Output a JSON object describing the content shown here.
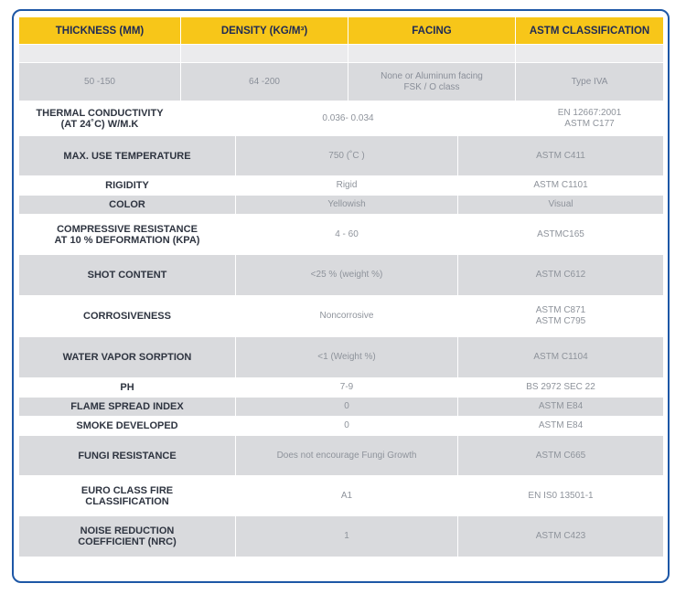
{
  "header": {
    "columns": [
      "THICKNESS (MM)",
      "DENSITY (KG/M³)",
      "FACING",
      "ASTM CLASSIFICATION"
    ]
  },
  "spec_row": {
    "thickness": "50 -150",
    "density": "64 -200",
    "facing_line1": "None or Aluminum facing",
    "facing_line2": "FSK / O class",
    "classification": "Type IVA"
  },
  "properties": [
    {
      "name_line1": "THERMAL CONDUCTIVITY",
      "name_line2": "(AT 24˚C) W/M.K",
      "value": "0.036- 0.034",
      "standard_line1": "EN 12667:2001",
      "standard_line2": "ASTM C177"
    },
    {
      "name_line1": "MAX. USE TEMPERATURE",
      "name_line2": "",
      "value": "750 (˚C )",
      "standard_line1": "ASTM C411",
      "standard_line2": ""
    },
    {
      "name_line1": "RIGIDITY",
      "name_line2": "",
      "value": "Rigid",
      "standard_line1": "ASTM C1101",
      "standard_line2": ""
    },
    {
      "name_line1": "COLOR",
      "name_line2": "",
      "value": "Yellowish",
      "standard_line1": "Visual",
      "standard_line2": ""
    },
    {
      "name_line1": "COMPRESSIVE RESISTANCE",
      "name_line2": "AT 10 % DEFORMATION (KPA)",
      "value": "4 - 60",
      "standard_line1": "ASTMC165",
      "standard_line2": ""
    },
    {
      "name_line1": "SHOT CONTENT",
      "name_line2": "",
      "value": "<25 % (weight %)",
      "standard_line1": "ASTM C612",
      "standard_line2": ""
    },
    {
      "name_line1": "CORROSIVENESS",
      "name_line2": "",
      "value": "Noncorrosive",
      "standard_line1": "ASTM C871",
      "standard_line2": "ASTM C795"
    },
    {
      "name_line1": "WATER VAPOR SORPTION",
      "name_line2": "",
      "value": "<1 (Weight %)",
      "standard_line1": "ASTM C1104",
      "standard_line2": ""
    },
    {
      "name_line1": "PH",
      "name_line2": "",
      "value": "7-9",
      "standard_line1": "BS 2972 SEC 22",
      "standard_line2": ""
    },
    {
      "name_line1": "FLAME SPREAD INDEX",
      "name_line2": "",
      "value": "0",
      "standard_line1": "ASTM E84",
      "standard_line2": ""
    },
    {
      "name_line1": "SMOKE DEVELOPED",
      "name_line2": "",
      "value": "0",
      "standard_line1": "ASTM E84",
      "standard_line2": ""
    },
    {
      "name_line1": "FUNGI RESISTANCE",
      "name_line2": "",
      "value": "Does not encourage Fungi Growth",
      "standard_line1": "ASTM C665",
      "standard_line2": ""
    },
    {
      "name_line1": "EURO CLASS FIRE",
      "name_line2": "CLASSIFICATION",
      "value": "A1",
      "standard_line1": "EN IS0 13501-1",
      "standard_line2": ""
    },
    {
      "name_line1": "NOISE REDUCTION",
      "name_line2": "COEFFICIENT (NRC)",
      "value": "1",
      "standard_line1": "ASTM C423",
      "standard_line2": ""
    }
  ],
  "colors": {
    "header_bg": "#f7c619",
    "header_text": "#1e2a55",
    "frame_border": "#1d57a6",
    "grey_row": "#d9dadd",
    "white_row": "#ffffff"
  }
}
